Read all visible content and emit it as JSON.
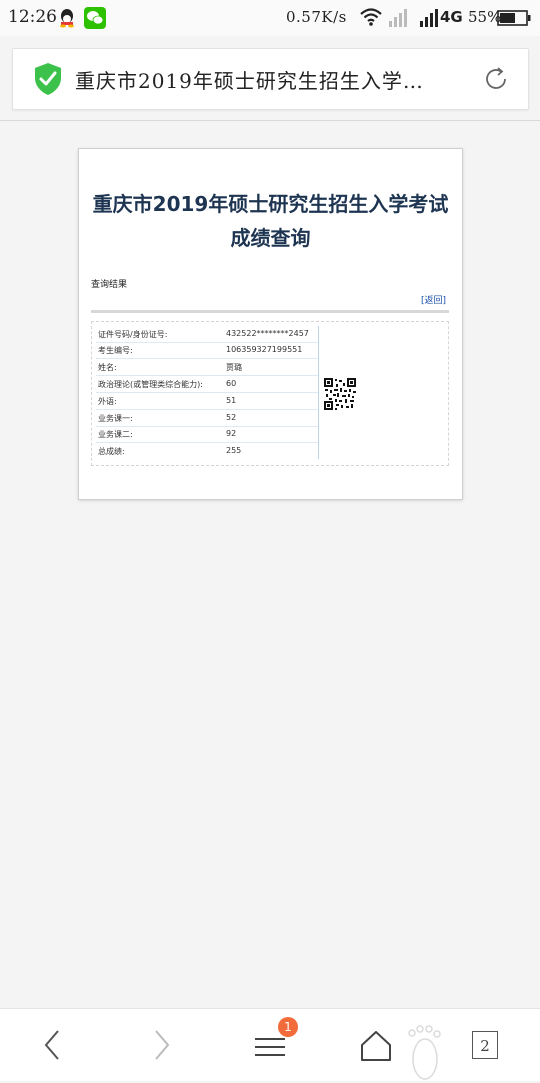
{
  "status_bar": {
    "time": "12:26",
    "network_speed": "0.57K/s",
    "network_type": "4G",
    "battery": "55%"
  },
  "address_bar": {
    "title": "重庆市2019年硕士研究生招生入学…"
  },
  "page": {
    "title": "重庆市2019年硕士研究生招生入学考试成绩查询",
    "result_label": "查询结果",
    "back_link": "[返回]",
    "rows": [
      {
        "label": "证件号码/身份证号:",
        "value": "432522********2457"
      },
      {
        "label": "考生编号:",
        "value": "106359327199551"
      },
      {
        "label": "姓名:",
        "value": "贾璐"
      },
      {
        "label": "政治理论(或管理类综合能力):",
        "value": "60"
      },
      {
        "label": "外语:",
        "value": "51"
      },
      {
        "label": "业务课一:",
        "value": "52"
      },
      {
        "label": "业务课二:",
        "value": "92"
      },
      {
        "label": "总成绩:",
        "value": "255"
      }
    ]
  },
  "toolbar": {
    "menu_badge": "1",
    "tab_count": "2"
  },
  "colors": {
    "accent_green": "#3cc24a",
    "title_navy": "#1e3552",
    "link_blue": "#1b4fa8",
    "badge_orange": "#f26b3a"
  },
  "icons": [
    "qq-icon",
    "wechat-icon",
    "wifi-icon",
    "signal-icon",
    "battery-icon",
    "shield-check-icon",
    "reload-icon",
    "qr-code",
    "back-arrow-icon",
    "forward-arrow-icon",
    "menu-icon",
    "home-icon",
    "footprint-icon"
  ]
}
